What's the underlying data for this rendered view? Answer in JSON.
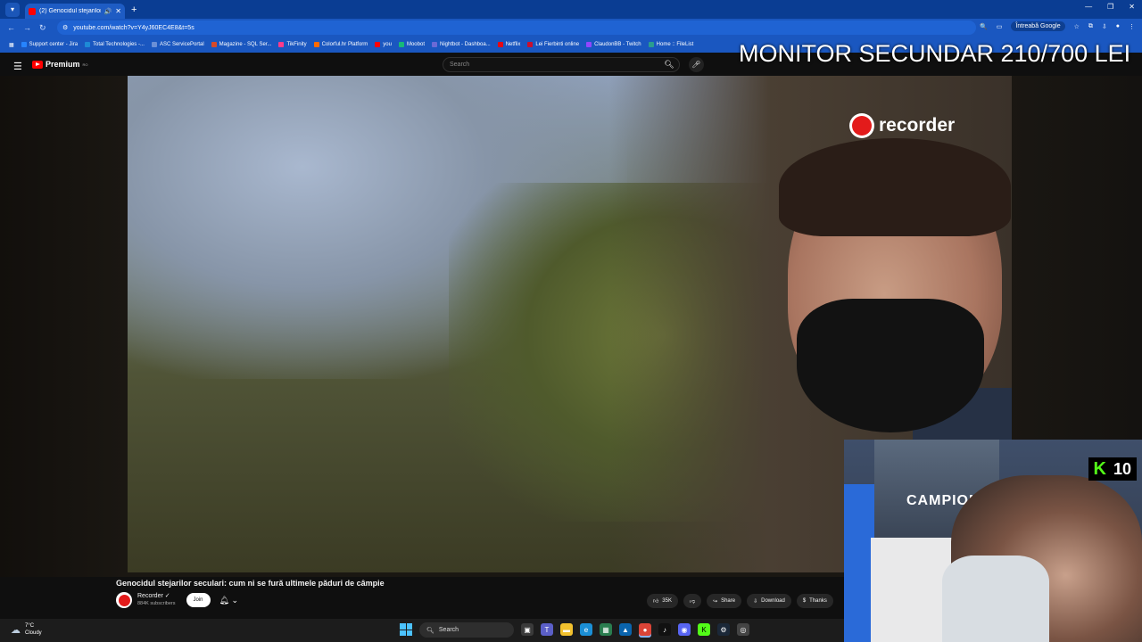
{
  "browser": {
    "tab_title": "(2) Genocidul stejarilor secu...",
    "url": "youtube.com/watch?v=Y4yJ60EC4E8&t=5s",
    "google_button": "Întreabă Google",
    "bookmarks": [
      "Support center - Jira",
      "Total Technologies -...",
      "ASC ServicePortal",
      "Magazine - SQL Ser...",
      "TikFinity",
      "Colorful.hr Platform",
      "you",
      "Moobot",
      "Nightbot - Dashboa...",
      "Netflix",
      "Lei Fierbinti online",
      "ClaudonBB - Twitch",
      "Home :: FileList"
    ],
    "bookmark_colors": [
      "#2684ff",
      "#1e8ad6",
      "#6a8fd6",
      "#d64a2a",
      "#ff3b8a",
      "#ff6a00",
      "#ff0000",
      "#17b978",
      "#6a6ad6",
      "#e50914",
      "#c8102e",
      "#9146ff",
      "#2a9d8f"
    ]
  },
  "youtube": {
    "logo_text": "Premium",
    "logo_region": "RO",
    "search_placeholder": "Search",
    "video_title": "Genocidul stejarilor seculari: cum ni se fură ultimele păduri de câmpie",
    "channel_name": "Recorder",
    "channel_verified": "✓",
    "subscribers": "884K subscribers",
    "join_label": "Join",
    "like_count": "35K",
    "share_label": "Share",
    "download_label": "Download",
    "thanks_label": "Thanks"
  },
  "overlay": {
    "monitor_text": "MONITOR SECUNDAR 210/700 LEI",
    "recorder_watermark": "recorder",
    "kick_count": "10",
    "camp_text": "CAMPION"
  },
  "taskbar": {
    "temperature": "7°C",
    "weather": "Cloudy",
    "search_label": "Search"
  },
  "colors": {
    "accent": "#1a57c0",
    "youtube_red": "#ff0000",
    "kick_green": "#53fc18"
  }
}
